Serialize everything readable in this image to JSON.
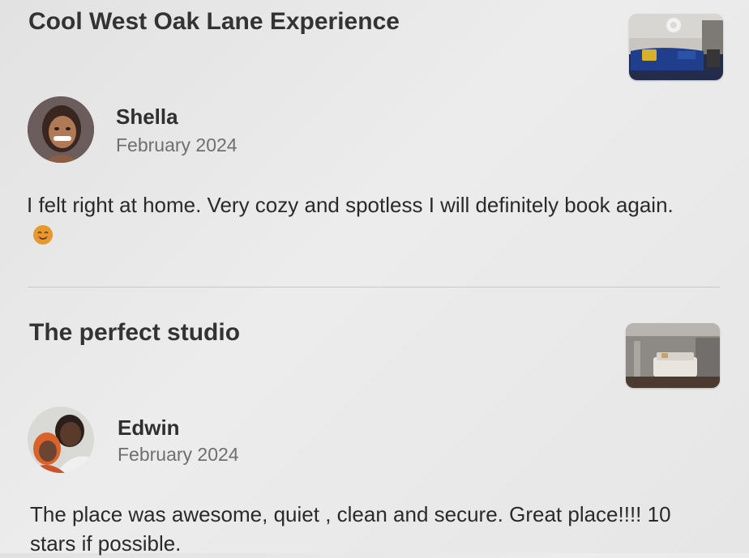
{
  "reviews": [
    {
      "title": "Cool West Oak Lane Experience",
      "reviewer": "Shella",
      "date": "February 2024",
      "text": "I felt right at home. Very cozy and spotless I will definitely book again.",
      "emoji_icon": "smiling-face-icon",
      "photo": "living-room-photo"
    },
    {
      "title": "The perfect studio",
      "reviewer": "Edwin",
      "date": "February 2024",
      "text": "The place was awesome, quiet , clean and secure. Great place!!!! 10 stars if possible.",
      "photo": "bedroom-photo"
    }
  ],
  "colors": {
    "text": "#2b2b2b",
    "muted": "#6f6f6f",
    "divider": "#c8c8c8",
    "emoji": "#e79a2c"
  }
}
